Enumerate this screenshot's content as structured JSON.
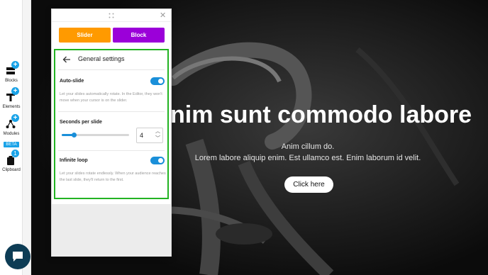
{
  "sidebar": {
    "items": [
      {
        "label": "Blocks",
        "icon": "blocks-icon",
        "badge": "+"
      },
      {
        "label": "Elements",
        "icon": "elements-icon",
        "badge": "+"
      },
      {
        "label": "Modules",
        "icon": "modules-icon",
        "badge": "+",
        "tag": "BETA"
      },
      {
        "label": "Clipboard",
        "icon": "clipboard-icon",
        "badge": "1"
      }
    ]
  },
  "panel": {
    "close_glyph": "✕",
    "tabs": [
      {
        "label": "Slider",
        "color": "#ff9a00"
      },
      {
        "label": "Block",
        "color": "#9b00d9"
      }
    ],
    "settings": {
      "title": "General settings",
      "auto_slide": {
        "label": "Auto-slide",
        "enabled": true,
        "hint": "Let your slides automatically rotate. In the Editor, they won't move when your cursor is on the slider."
      },
      "seconds_per_slide": {
        "label": "Seconds per slide",
        "value": "4",
        "slider_fraction": 0.18
      },
      "infinite_loop": {
        "label": "Infinite loop",
        "enabled": true,
        "hint": "Let your slides rotate endlessly. When your audience reaches the last slide, they'll return to the first."
      }
    }
  },
  "hero": {
    "title": "nim sunt commodo labore",
    "subtitle_1": "Anim cillum do.",
    "subtitle_2": "Lorem labore aliquip enim. Est ullamco est. Enim laborum id velit.",
    "button_label": "Click here"
  },
  "colors": {
    "accent": "#1a8fd9",
    "highlight_border": "#22b322",
    "hero_bg": "#0b0b0b"
  }
}
